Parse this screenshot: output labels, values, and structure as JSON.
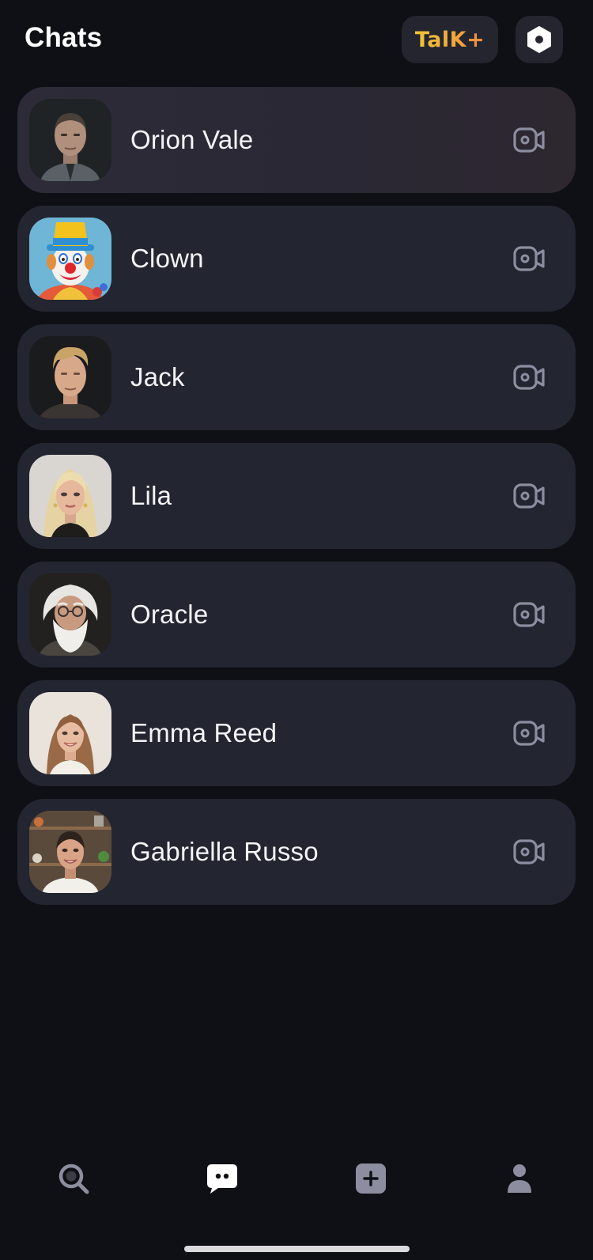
{
  "header": {
    "title": "Chats",
    "talk_plus_label": "TalK+",
    "settings_icon": "settings-hexagon-icon"
  },
  "chats": [
    {
      "name": "Orion Vale",
      "avatar": "man-short-hair-avatar",
      "action_icon": "video-call-icon",
      "active": true
    },
    {
      "name": "Clown",
      "avatar": "clown-avatar",
      "action_icon": "video-call-icon"
    },
    {
      "name": "Jack",
      "avatar": "blond-man-avatar",
      "action_icon": "video-call-icon"
    },
    {
      "name": "Lila",
      "avatar": "blonde-woman-avatar",
      "action_icon": "video-call-icon"
    },
    {
      "name": "Oracle",
      "avatar": "old-wizard-avatar",
      "action_icon": "video-call-icon"
    },
    {
      "name": "Emma Reed",
      "avatar": "smiling-woman-avatar",
      "action_icon": "video-call-icon"
    },
    {
      "name": "Gabriella Russo",
      "avatar": "chef-woman-avatar",
      "action_icon": "video-call-icon"
    }
  ],
  "bottom_nav": [
    {
      "icon": "search-icon",
      "active": false
    },
    {
      "icon": "chat-bubble-icon",
      "active": true
    },
    {
      "icon": "create-plus-icon",
      "active": false
    },
    {
      "icon": "profile-icon",
      "active": false
    }
  ],
  "colors": {
    "background": "#0f1016",
    "card": "#232530",
    "icon_muted": "#8c8ea0",
    "accent_yellow": "#f0c438",
    "accent_orange": "#f08a3c"
  }
}
